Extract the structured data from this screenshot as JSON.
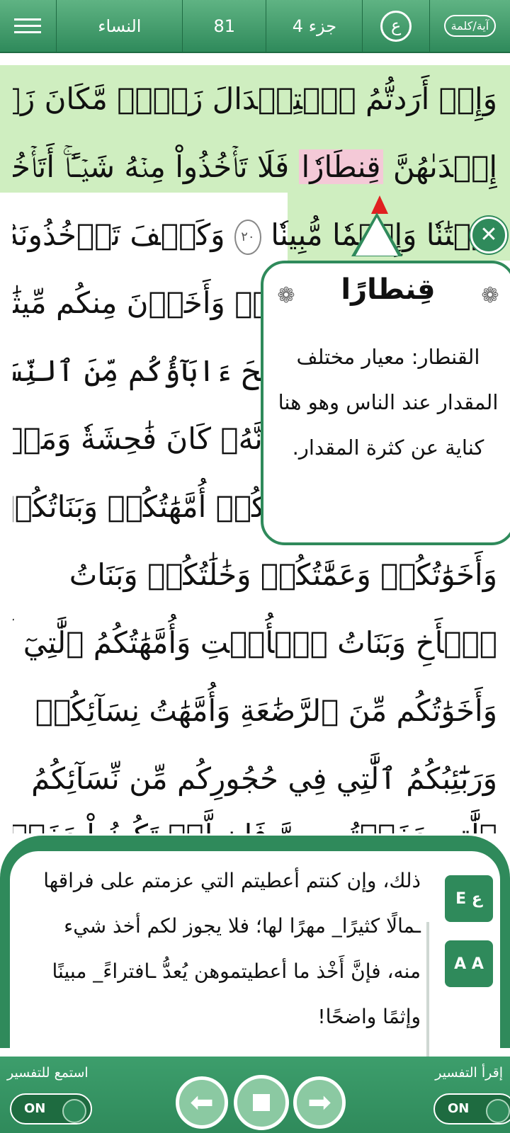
{
  "topbar": {
    "aya_word_icon": "آية/كلمة",
    "ayn_icon": "ع",
    "juz": "جزء 4",
    "page": "81",
    "surah": "النساء"
  },
  "quran": {
    "lines": [
      "وَإِنۡ أَرَدتُّمُ ٱسۡتِبۡدَالَ زَوۡجٖ مَّكَانَ زَوۡجٖ وَءَاتَيۡتُمۡ",
      "إِحۡدَىٰهُنَّ",
      "قِنطَارٗا",
      "فَلَا تَأۡخُذُواْ مِنۡهُ شَيۡـًٔاۚ أَتَأۡخُذُونَهُۥ",
      "بُهۡتَٰنٗا وَإِثۡمٗا مُّبِينٗا",
      "٢٠",
      "وَكَيۡفَ تَأۡخُذُونَهُۥ وَقَدۡ أَفۡضَىٰ",
      "بَعۡضُكُمۡ إِلَىٰ بَعۡضٖ وَأَخَذۡنَ مِنكُم مِّيثَٰقًا غَلِيظٗا",
      "وَلَا تَنكِحُواْ مَا نَكَحَ ءَابَآؤُكُم مِّنَ ٱلنِّسَآءِ",
      "إِلَّا مَا قَدۡ سَلَفَۚ إِنَّهُۥ كَانَ فَٰحِشَةٗ وَمَقۡتٗا وَسَآءَ",
      "سَبِيلًا حُرِّمَتۡ عَلَيۡكُمۡ أُمَّهَٰتُكُمۡ وَبَنَاتُكُمۡ",
      "وَأَخَوَٰتُكُمۡ وَعَمَّٰتُكُمۡ وَخَٰلَٰتُكُمۡ وَبَنَاتُ",
      "ٱلۡأَخِ وَبَنَاتُ ٱلۡأُخۡتِ وَأُمَّهَٰتُكُمُ ٱلَّٰتِيٓ أَرۡضَعۡنَكُمۡ",
      "وَأَخَوَٰتُكُم مِّنَ ٱلرَّضَٰعَةِ وَأُمَّهَٰتُ نِسَآئِكُمۡ",
      "وَرَبَٰٓئِبُكُمُ ٱلَّٰتِي فِي حُجُورِكُم مِّن نِّسَآئِكُمُ",
      "ٱلَّٰتِي دَخَلۡتُم بِهِنَّ فَإِن لَّمۡ تَكُونُواْ دَخَلۡتُم بِهِنَّ فَلَا"
    ]
  },
  "popup": {
    "title": "قِنطارًا",
    "body": "القنطار: معيار مختلف المقدار عند الناس وهو هنا كناية عن كثرة المقدار."
  },
  "tafsir": {
    "text": "ذلك، وإن كنتم أعطيتم التي عزمتم على فراقها ـمالًا كثيرًا_ مهرًا لها؛ فلا يجوز لكم أخذ شيء منه، فإنَّ أَخْذ ما أعطيتموهن يُعدُّ ـافتراءً_ مبينًا وإثمًا واضحًا!",
    "translate_icon": "E ع",
    "font_icon": "A A"
  },
  "bottombar": {
    "read_tafsir": "إقرأ التفسير",
    "listen_tafsir": "استمع للتفسير",
    "toggle_left": "ON",
    "toggle_right": "ON"
  },
  "colors": {
    "primary": "#2f8a5b",
    "highlight": "#cfeec0",
    "word_highlight": "#f4c9d7"
  }
}
